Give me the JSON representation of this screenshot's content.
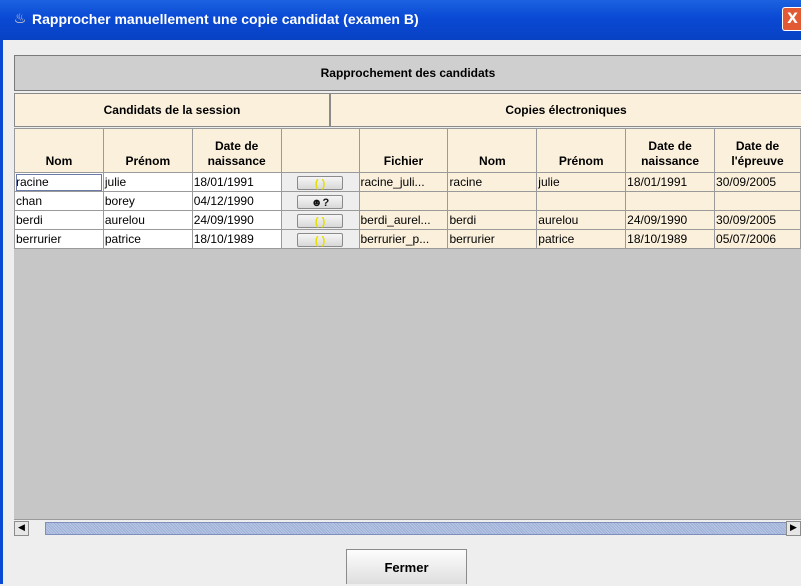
{
  "window": {
    "title": "Rapprocher manuellement une copie candidat (examen B)",
    "close_label": "X"
  },
  "panel": {
    "title": "Rapprochement des candidats",
    "group_candidates": "Candidats de la session",
    "group_copies": "Copies électroniques"
  },
  "columns": {
    "nom": "Nom",
    "prenom": "Prénom",
    "date_naissance_1": "Date de",
    "date_naissance_2": "naissance",
    "action": "",
    "fichier": "Fichier",
    "nom2": "Nom",
    "prenom2": "Prénom",
    "date_naissance2_1": "Date de",
    "date_naissance2_2": "naissance",
    "date_epreuve_1": "Date de",
    "date_epreuve_2": "l'épreuve"
  },
  "rows": [
    {
      "nom": "racine",
      "prenom": "julie",
      "naissance": "18/01/1991",
      "action_icon": "link-icon",
      "fichier": "racine_juli...",
      "nom2": "racine",
      "prenom2": "julie",
      "naissance2": "18/01/1991",
      "epreuve": "30/09/2005"
    },
    {
      "nom": "chan",
      "prenom": "borey",
      "naissance": "04/12/1990",
      "action_icon": "people-icon",
      "fichier": "",
      "nom2": "",
      "prenom2": "",
      "naissance2": "",
      "epreuve": ""
    },
    {
      "nom": "berdi",
      "prenom": "aurelou",
      "naissance": "24/09/1990",
      "action_icon": "link-icon",
      "fichier": "berdi_aurel...",
      "nom2": "berdi",
      "prenom2": "aurelou",
      "naissance2": "24/09/1990",
      "epreuve": "30/09/2005"
    },
    {
      "nom": "berrurier",
      "prenom": "patrice",
      "naissance": "18/10/1989",
      "action_icon": "link-icon",
      "fichier": "berrurier_p...",
      "nom2": "berrurier",
      "prenom2": "patrice",
      "naissance2": "18/10/1989",
      "epreuve": "05/07/2006"
    }
  ],
  "footer": {
    "close_button": "Fermer"
  },
  "colors": {
    "titlebar": "#0a49d4",
    "header_bg": "#faf0dc",
    "group_bg": "#cfcfcf",
    "grid_bg": "#c6c6c6"
  }
}
